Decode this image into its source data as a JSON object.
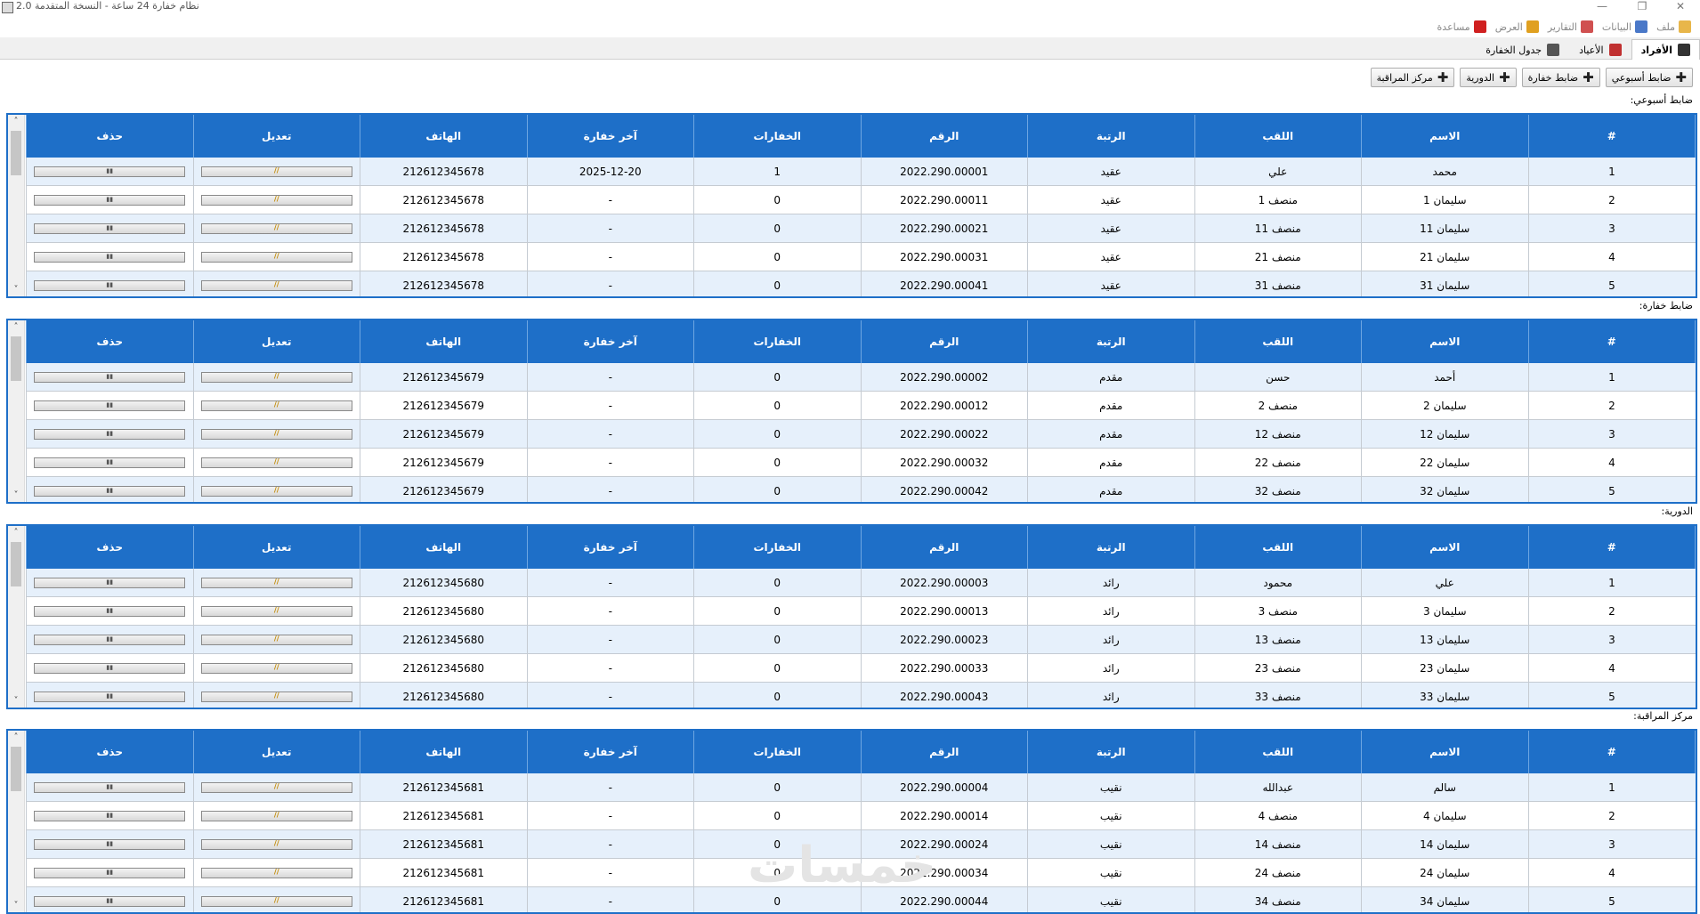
{
  "window": {
    "title": "نظام خفارة 24 ساعة - النسخة المتقدمة 2.0",
    "controls": [
      "—",
      "❐",
      "✕"
    ]
  },
  "menu": [
    {
      "label": "ملف",
      "icon": "folder-icon",
      "color": "#e8b64a"
    },
    {
      "label": "البيانات",
      "icon": "bar-chart-icon",
      "color": "#4a78c8"
    },
    {
      "label": "التقارير",
      "icon": "line-chart-icon",
      "color": "#d05050"
    },
    {
      "label": "العرض",
      "icon": "palette-icon",
      "color": "#e0a020"
    },
    {
      "label": "مساعدة",
      "icon": "question-icon",
      "color": "#d02020"
    }
  ],
  "tabs": [
    {
      "label": "الأفراد",
      "icon": "people-icon",
      "active": true
    },
    {
      "label": "الأعياد",
      "icon": "calendar-icon",
      "active": false
    },
    {
      "label": "جدول الخفارة",
      "icon": "document-icon",
      "active": false
    }
  ],
  "buttons": [
    "ضابط أسبوعي",
    "ضابط خفارة",
    "الدورية",
    "مركز المراقبة"
  ],
  "columns": [
    "#",
    "الاسم",
    "اللقب",
    "الرتبة",
    "الرقم",
    "الخفارات",
    "آخر خفارة",
    "الهاتف",
    "تعديل",
    "حذف"
  ],
  "sections": [
    {
      "label": "ضابط أسبوعي:",
      "rows": [
        [
          "1",
          "محمد",
          "علي",
          "عقيد",
          "2022.290.00001",
          "1",
          "2025-12-20",
          "212612345678"
        ],
        [
          "2",
          "سليمان 1",
          "منصف 1",
          "عقيد",
          "2022.290.00011",
          "0",
          "-",
          "212612345678"
        ],
        [
          "3",
          "سليمان 11",
          "منصف 11",
          "عقيد",
          "2022.290.00021",
          "0",
          "-",
          "212612345678"
        ],
        [
          "4",
          "سليمان 21",
          "منصف 21",
          "عقيد",
          "2022.290.00031",
          "0",
          "-",
          "212612345678"
        ],
        [
          "5",
          "سليمان 31",
          "منصف 31",
          "عقيد",
          "2022.290.00041",
          "0",
          "-",
          "212612345678"
        ]
      ]
    },
    {
      "label": "ضابط خفارة:",
      "rows": [
        [
          "1",
          "أحمد",
          "حسن",
          "مقدم",
          "2022.290.00002",
          "0",
          "-",
          "212612345679"
        ],
        [
          "2",
          "سليمان 2",
          "منصف 2",
          "مقدم",
          "2022.290.00012",
          "0",
          "-",
          "212612345679"
        ],
        [
          "3",
          "سليمان 12",
          "منصف 12",
          "مقدم",
          "2022.290.00022",
          "0",
          "-",
          "212612345679"
        ],
        [
          "4",
          "سليمان 22",
          "منصف 22",
          "مقدم",
          "2022.290.00032",
          "0",
          "-",
          "212612345679"
        ],
        [
          "5",
          "سليمان 32",
          "منصف 32",
          "مقدم",
          "2022.290.00042",
          "0",
          "-",
          "212612345679"
        ]
      ]
    },
    {
      "label": "الدورية:",
      "rows": [
        [
          "1",
          "علي",
          "محمود",
          "رائد",
          "2022.290.00003",
          "0",
          "-",
          "212612345680"
        ],
        [
          "2",
          "سليمان 3",
          "منصف 3",
          "رائد",
          "2022.290.00013",
          "0",
          "-",
          "212612345680"
        ],
        [
          "3",
          "سليمان 13",
          "منصف 13",
          "رائد",
          "2022.290.00023",
          "0",
          "-",
          "212612345680"
        ],
        [
          "4",
          "سليمان 23",
          "منصف 23",
          "رائد",
          "2022.290.00033",
          "0",
          "-",
          "212612345680"
        ],
        [
          "5",
          "سليمان 33",
          "منصف 33",
          "رائد",
          "2022.290.00043",
          "0",
          "-",
          "212612345680"
        ]
      ]
    },
    {
      "label": "مركز المراقبة:",
      "rows": [
        [
          "1",
          "سالم",
          "عبدالله",
          "نقيب",
          "2022.290.00004",
          "0",
          "-",
          "212612345681"
        ],
        [
          "2",
          "سليمان 4",
          "منصف 4",
          "نقيب",
          "2022.290.00014",
          "0",
          "-",
          "212612345681"
        ],
        [
          "3",
          "سليمان 14",
          "منصف 14",
          "نقيب",
          "2022.290.00024",
          "0",
          "-",
          "212612345681"
        ],
        [
          "4",
          "سليمان 24",
          "منصف 24",
          "نقيب",
          "2022.290.00034",
          "0",
          "-",
          "212612345681"
        ],
        [
          "5",
          "سليمان 34",
          "منصف 34",
          "نقيب",
          "2022.290.00044",
          "0",
          "-",
          "212612345681"
        ]
      ]
    }
  ],
  "watermark": "خمسات"
}
